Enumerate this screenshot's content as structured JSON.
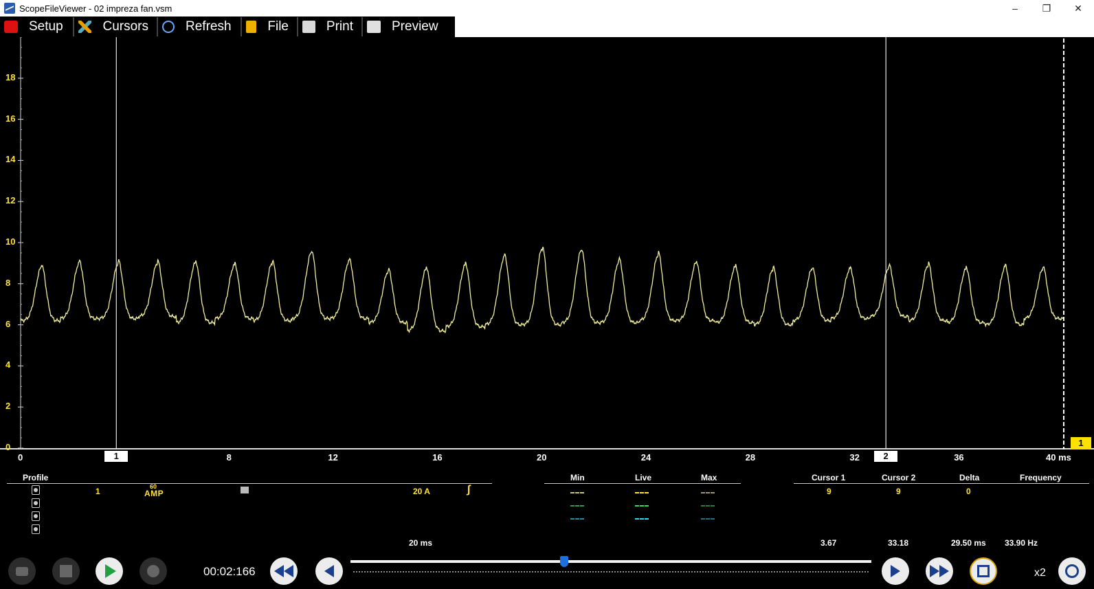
{
  "window": {
    "title": "ScopeFileViewer - 02 impreza fan.vsm"
  },
  "toolbar": {
    "setup": "Setup",
    "cursors": "Cursors",
    "refresh": "Refresh",
    "file": "File",
    "print": "Print",
    "preview": "Preview"
  },
  "colors": {
    "trace": "#f2f0a0",
    "axis_label": "#ffe23a",
    "background": "#000000"
  },
  "chart_data": {
    "type": "line",
    "xlabel": "ms",
    "xlim": [
      0,
      40
    ],
    "ylim": [
      0,
      20
    ],
    "y_ticks": [
      "0",
      "2",
      "4",
      "6",
      "8",
      "10",
      "12",
      "14",
      "16",
      "18"
    ],
    "x_ticks": [
      "0",
      "4",
      "8",
      "12",
      "16",
      "20",
      "24",
      "28",
      "32",
      "36",
      "40 ms"
    ],
    "peaks_x_ms": [
      0.8,
      2.25,
      3.75,
      5.25,
      6.7,
      8.2,
      9.65,
      11.15,
      12.6,
      14.1,
      15.55,
      17.05,
      18.55,
      20.0,
      21.5,
      22.95,
      24.45,
      25.9,
      27.4,
      28.85,
      30.35,
      31.8,
      33.3,
      34.8,
      36.25,
      37.75,
      39.2
    ],
    "peaks_y": [
      8.8,
      9.0,
      9.0,
      9.0,
      9.0,
      8.9,
      9.0,
      9.5,
      9.1,
      8.6,
      8.7,
      8.9,
      9.3,
      9.7,
      9.6,
      9.1,
      9.4,
      9.0,
      8.8,
      8.7,
      8.7,
      8.7,
      8.8,
      8.9,
      8.7,
      8.8,
      8.7
    ],
    "baseline_y": [
      6.2,
      6.3,
      6.3,
      6.4,
      6.1,
      6.3,
      6.2,
      6.3,
      6.3,
      6.1,
      5.7,
      5.9,
      6.0,
      6.0,
      6.1,
      6.1,
      6.2,
      6.2,
      6.1,
      6.0,
      6.2,
      6.3,
      6.4,
      6.2,
      6.1,
      6.0,
      6.3
    ],
    "cursor1_x_ms": 3.67,
    "cursor2_x_ms": 33.18,
    "cursor1_label": "1",
    "cursor2_label": "2",
    "channel_tag": "1"
  },
  "info": {
    "profile_header": "Profile",
    "channel": "1",
    "amp_top": "60",
    "amp_bottom": "AMP",
    "scale": "20 A",
    "timebase": "20 ms",
    "min_header": "Min",
    "live_header": "Live",
    "max_header": "Max",
    "cursor1_header": "Cursor 1",
    "cursor2_header": "Cursor 2",
    "delta_header": "Delta",
    "frequency_header": "Frequency",
    "cursor1_value": "9",
    "cursor2_value": "9",
    "delta_value": "0",
    "cursor1_time": "3.67",
    "cursor2_time": "33.18",
    "delta_time": "29.50 ms",
    "frequency": "33.90 Hz"
  },
  "playback": {
    "time": "00:02:166",
    "zoom": "x2",
    "slider_position": 0.41
  }
}
